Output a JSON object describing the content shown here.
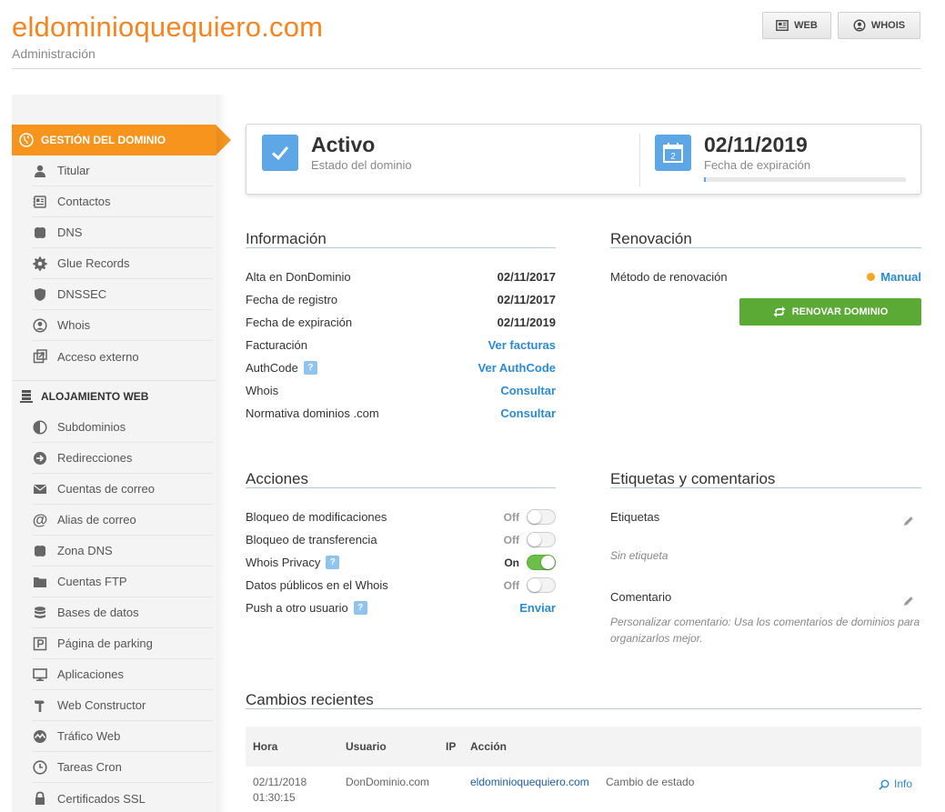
{
  "header": {
    "domain": "eldominioquequiero.com",
    "subtitle": "Administración",
    "btn_web": "WEB",
    "btn_whois": "WHOIS"
  },
  "sidebar": {
    "active": "GESTIÓN DEL DOMINIO",
    "group1": [
      {
        "label": "Titular",
        "icon": "user-icon"
      },
      {
        "label": "Contactos",
        "icon": "contacts-icon"
      },
      {
        "label": "DNS",
        "icon": "dns-icon"
      },
      {
        "label": "Glue Records",
        "icon": "gear-icon"
      },
      {
        "label": "DNSSEC",
        "icon": "shield-icon"
      },
      {
        "label": "Whois",
        "icon": "user-circle-icon"
      },
      {
        "label": "Acceso externo",
        "icon": "external-icon"
      }
    ],
    "group2_title": "ALOJAMIENTO WEB",
    "group2": [
      {
        "label": "Subdominios",
        "icon": "half-circle-icon"
      },
      {
        "label": "Redirecciones",
        "icon": "arrow-right-circle-icon"
      },
      {
        "label": "Cuentas de correo",
        "icon": "envelope-icon"
      },
      {
        "label": "Alias de correo",
        "icon": "at-icon"
      },
      {
        "label": "Zona DNS",
        "icon": "dns-icon"
      },
      {
        "label": "Cuentas FTP",
        "icon": "folder-icon"
      },
      {
        "label": "Bases de datos",
        "icon": "database-icon"
      },
      {
        "label": "Página de parking",
        "icon": "parking-icon"
      },
      {
        "label": "Aplicaciones",
        "icon": "monitor-icon"
      },
      {
        "label": "Web Constructor",
        "icon": "hammer-icon"
      },
      {
        "label": "Tráfico Web",
        "icon": "pulse-icon"
      },
      {
        "label": "Tareas Cron",
        "icon": "clock-icon"
      },
      {
        "label": "Certificados SSL",
        "icon": "lock-icon"
      }
    ]
  },
  "status": {
    "state_value": "Activo",
    "state_label": "Estado del dominio",
    "expiry_value": "02/11/2019",
    "expiry_label": "Fecha de expiración",
    "calendar_day": "2",
    "expiry_progress": 0.01
  },
  "info": {
    "title": "Información",
    "rows": [
      {
        "label": "Alta en DonDominio",
        "value": "02/11/2017"
      },
      {
        "label": "Fecha de registro",
        "value": "02/11/2017"
      },
      {
        "label": "Fecha de expiración",
        "value": "02/11/2019"
      },
      {
        "label": "Facturación",
        "value": "Ver facturas"
      },
      {
        "label": "AuthCode",
        "value": "Ver AuthCode"
      },
      {
        "label": "Whois",
        "value": "Consultar"
      },
      {
        "label": "Normativa dominios .com",
        "value": "Consultar"
      }
    ]
  },
  "renewal": {
    "title": "Renovación",
    "method_label": "Método de renovación",
    "method_value": "Manual",
    "button": "RENOVAR DOMINIO"
  },
  "actions": {
    "title": "Acciones",
    "rows": [
      {
        "label": "Bloqueo de modificaciones",
        "state": "Off"
      },
      {
        "label": "Bloqueo de transferencia",
        "state": "Off"
      },
      {
        "label": "Whois Privacy",
        "state": "On"
      },
      {
        "label": "Datos públicos en el Whois",
        "state": "Off"
      },
      {
        "label": "Push a otro usuario",
        "link": "Enviar"
      }
    ],
    "help_mark": "?"
  },
  "tags": {
    "title": "Etiquetas y comentarios",
    "tags_label": "Etiquetas",
    "tags_empty": "Sin etiqueta",
    "comment_label": "Comentario",
    "comment_hint": "Personalizar comentario: Usa los comentarios de dominios para organizarlos mejor."
  },
  "changes": {
    "title": "Cambios recientes",
    "columns": [
      "Hora",
      "Usuario",
      "IP",
      "Acción"
    ],
    "row": {
      "date": "02/11/2018",
      "time": "01:30:15",
      "user": "DonDominio.com",
      "ip": "",
      "domain": "eldominioquequiero.com",
      "action": "Cambio de estado",
      "info": "Info"
    }
  }
}
